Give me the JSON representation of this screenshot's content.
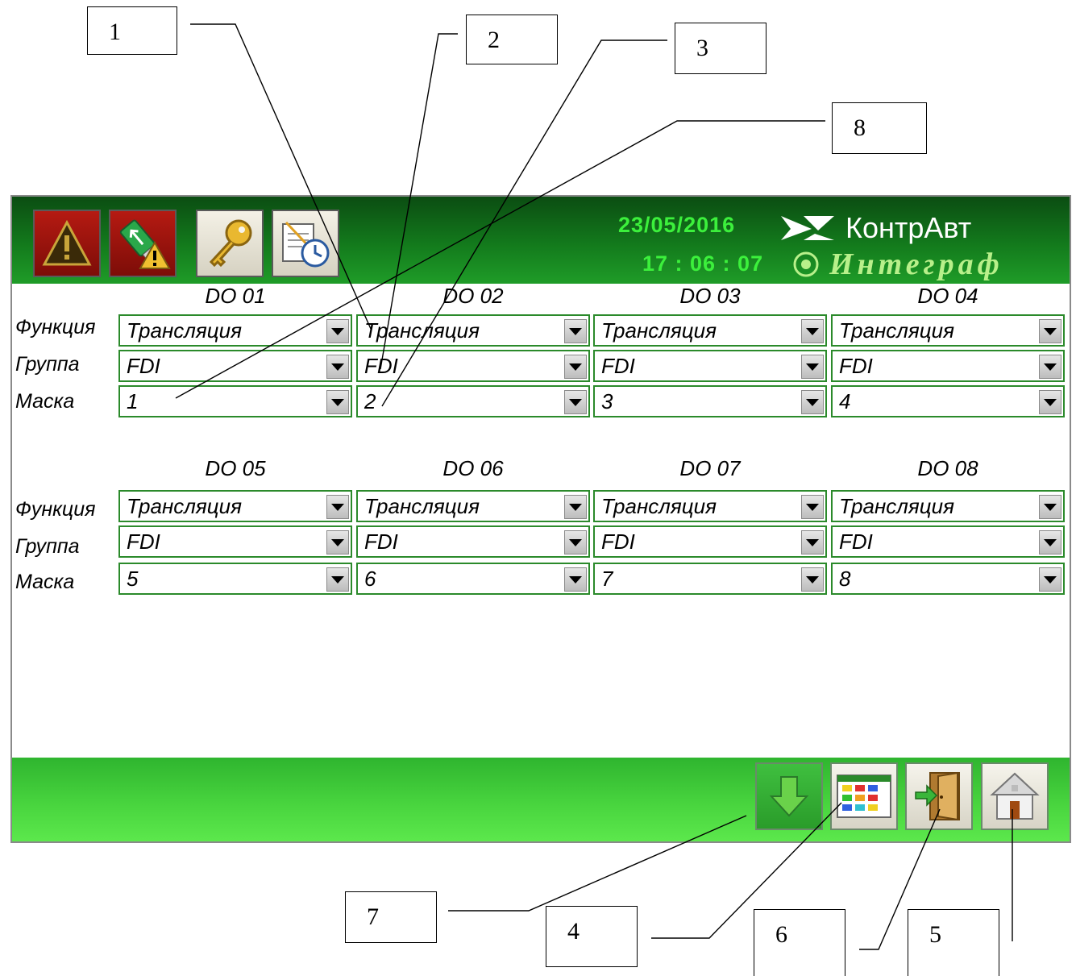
{
  "callouts": {
    "c1": "1",
    "c2": "2",
    "c3": "3",
    "c8": "8",
    "c7": "7",
    "c4": "4",
    "c6": "6",
    "c5": "5"
  },
  "header": {
    "date": "23/05/2016",
    "time": "17 : 06 : 07",
    "logo_top": "КонтрАвт",
    "logo_bottom": "Интеграф",
    "buttons": [
      "alarm-icon",
      "usb-alarm-icon",
      "key-icon",
      "log-clock-icon"
    ]
  },
  "labels": {
    "function": "Функция",
    "group": "Группа",
    "mask": "Маска"
  },
  "channels": [
    {
      "title": "DO 01",
      "function": "Трансляция",
      "group": "FDI",
      "mask": "1"
    },
    {
      "title": "DO 02",
      "function": "Трансляция",
      "group": "FDI",
      "mask": "2"
    },
    {
      "title": "DO 03",
      "function": "Трансляция",
      "group": "FDI",
      "mask": "3"
    },
    {
      "title": "DO 04",
      "function": "Трансляция",
      "group": "FDI",
      "mask": "4"
    },
    {
      "title": "DO 05",
      "function": "Трансляция",
      "group": "FDI",
      "mask": "5"
    },
    {
      "title": "DO 06",
      "function": "Трансляция",
      "group": "FDI",
      "mask": "6"
    },
    {
      "title": "DO 07",
      "function": "Трансляция",
      "group": "FDI",
      "mask": "7"
    },
    {
      "title": "DO 08",
      "function": "Трансляция",
      "group": "FDI",
      "mask": "8"
    }
  ],
  "footer": {
    "buttons": [
      "download-icon",
      "table-view-icon",
      "exit-door-icon",
      "home-icon"
    ]
  },
  "colors": {
    "header_dark": "#0b4d12",
    "datetime": "#3cf03c",
    "footer_green": "#48d43e",
    "combo_border": "#2b8a2b"
  }
}
